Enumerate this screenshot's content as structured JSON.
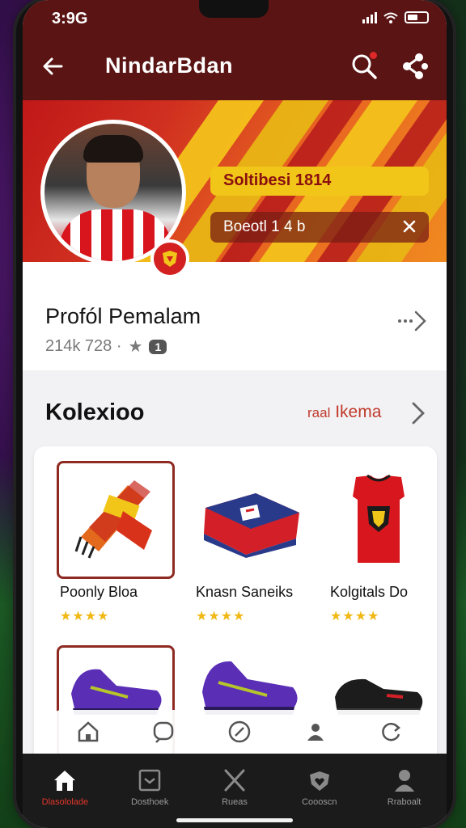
{
  "status": {
    "time": "3:9G"
  },
  "header": {
    "title": "NindarBdan"
  },
  "banner": {
    "pill_yellow": "Soltibesi 1814",
    "pill_dark": "Boeotl 1 4 b"
  },
  "profile": {
    "title": "Profól Pemalam",
    "stats": "214k 728 ·",
    "rank": "1"
  },
  "collection": {
    "title": "Kolexioo",
    "link_small": "raal",
    "link": "Ikema",
    "items": [
      {
        "name": "Poonly Bloa",
        "stars": "★★★★",
        "selected": true
      },
      {
        "name": "Knasn Saneiks",
        "stars": "★★★★",
        "selected": false
      },
      {
        "name": "Kolgitals Do",
        "stars": "★★★★",
        "selected": false
      }
    ]
  },
  "bottom_nav": [
    {
      "label": "Dlasololade",
      "icon": "home-icon",
      "active": true
    },
    {
      "label": "Dosthoek",
      "icon": "inbox-icon",
      "active": false
    },
    {
      "label": "Rueas",
      "icon": "swords-icon",
      "active": false
    },
    {
      "label": "Coooscn",
      "icon": "heart-shield-icon",
      "active": false
    },
    {
      "label": "Rraboalt",
      "icon": "profile-icon",
      "active": false
    }
  ],
  "colors": {
    "header_bg": "#5a1414",
    "accent_red": "#d32020",
    "accent_yellow": "#f1c618",
    "star": "#f1b814"
  }
}
